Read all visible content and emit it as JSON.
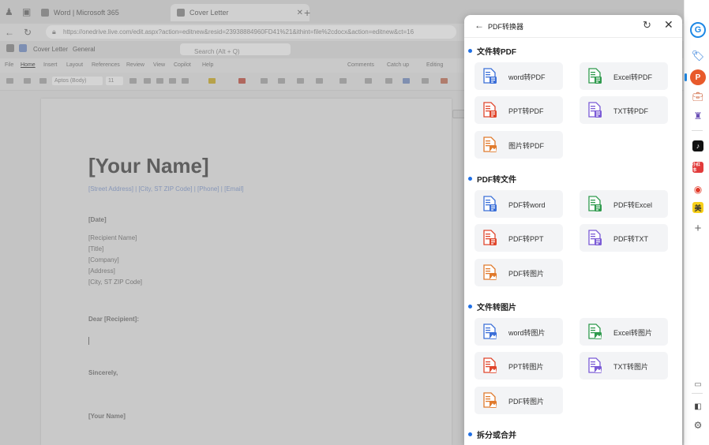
{
  "browser": {
    "tabs": [
      {
        "label": "Word | Microsoft 365"
      },
      {
        "label": "Cover Letter"
      }
    ],
    "address": "https://onedrive.live.com/edit.aspx?action=editnew&resid=23938884960FD41%21&ithint=file%2cdocx&action=editnew&ct=16",
    "word_title": "Cover Letter",
    "word_sensitivity": "General",
    "search_placeholder": "Search (Alt + Q)",
    "ribbon_tabs": [
      "File",
      "Home",
      "Insert",
      "Layout",
      "References",
      "Review",
      "View",
      "Copilot",
      "Help"
    ],
    "ribbon_right": [
      "Comments",
      "Catch up",
      "Editing"
    ],
    "font_name": "Aptos (Body)",
    "font_size": "11"
  },
  "document": {
    "name": "[Your Name]",
    "address_line": "[Street Address] | [City, ST ZIP Code] | [Phone] | [Email]",
    "date": "[Date]",
    "recipient_lines": [
      "[Recipient Name]",
      "[Title]",
      "[Company]",
      "[Address]",
      "[City, ST ZIP Code]"
    ],
    "salutation": "Dear [Recipient]:",
    "closing": "Sincerely,",
    "signature": "[Your Name]"
  },
  "panel": {
    "title": "PDF转换器",
    "sections": [
      {
        "title": "文件转PDF",
        "items": [
          {
            "label": "word转PDF",
            "icon": "word-to-pdf-icon",
            "color": "#3b6fd8"
          },
          {
            "label": "Excel转PDF",
            "icon": "excel-to-pdf-icon",
            "color": "#2f9a4d"
          },
          {
            "label": "PPT转PDF",
            "icon": "ppt-to-pdf-icon",
            "color": "#e0462c"
          },
          {
            "label": "TXT转PDF",
            "icon": "txt-to-pdf-icon",
            "color": "#7b5bd6"
          },
          {
            "label": "图片转PDF",
            "icon": "image-to-pdf-icon",
            "color": "#e07a2c"
          }
        ]
      },
      {
        "title": "PDF转文件",
        "items": [
          {
            "label": "PDF转word",
            "icon": "pdf-to-word-icon",
            "color": "#3b6fd8"
          },
          {
            "label": "PDF转Excel",
            "icon": "pdf-to-excel-icon",
            "color": "#2f9a4d"
          },
          {
            "label": "PDF转PPT",
            "icon": "pdf-to-ppt-icon",
            "color": "#e0462c"
          },
          {
            "label": "PDF转TXT",
            "icon": "pdf-to-txt-icon",
            "color": "#7b5bd6"
          },
          {
            "label": "PDF转图片",
            "icon": "pdf-to-image-icon",
            "color": "#e07a2c"
          }
        ]
      },
      {
        "title": "文件转图片",
        "items": [
          {
            "label": "word转图片",
            "icon": "word-to-image-icon",
            "color": "#3b6fd8"
          },
          {
            "label": "Excel转图片",
            "icon": "excel-to-image-icon",
            "color": "#2f9a4d"
          },
          {
            "label": "PPT转图片",
            "icon": "ppt-to-image-icon",
            "color": "#e0462c"
          },
          {
            "label": "TXT转图片",
            "icon": "txt-to-image-icon",
            "color": "#7b5bd6"
          },
          {
            "label": "PDF转图片",
            "icon": "pdf-to-image-icon",
            "color": "#e07a2c"
          }
        ]
      },
      {
        "title": "拆分或合并",
        "items": []
      }
    ]
  },
  "sidebar": {
    "icons": [
      "copilot-icon",
      "tag-icon",
      "pdf-converter-icon",
      "toolbox-icon",
      "chess-icon",
      "tiktok-icon",
      "xiaohongshu-icon",
      "weibo-icon",
      "meituan-icon",
      "add-icon",
      "screen-icon",
      "layout-icon",
      "settings-icon"
    ],
    "xhs_text": "小红书",
    "meituan_text": "美"
  },
  "colors": {
    "accent": "#1f6fe5",
    "overlay": "#c9c9c9"
  }
}
